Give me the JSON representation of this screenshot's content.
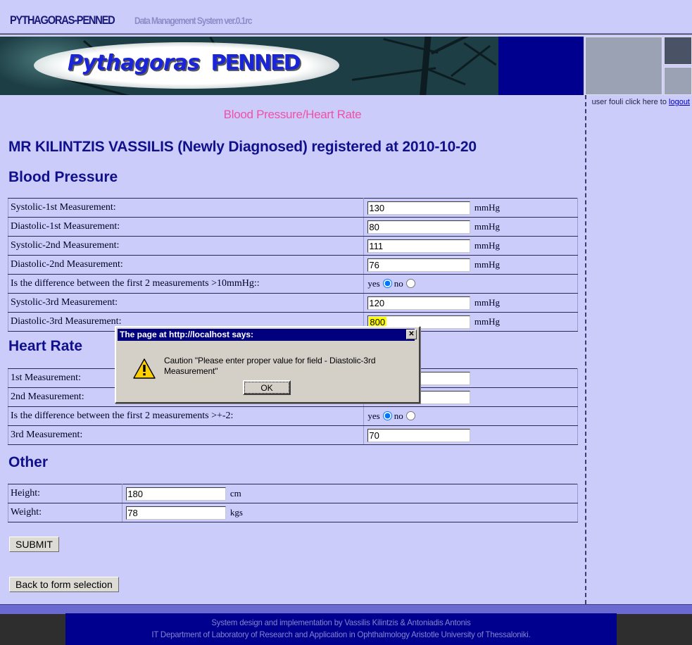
{
  "titlebar": {
    "app_name": "PYTHAGORAS-PENNED",
    "app_subtitle": "Data Management System ver.0.1rc"
  },
  "banner": {
    "logo_first": "Pythagoras",
    "logo_second": "PENNED"
  },
  "session": {
    "prefix": "user fouli click here to",
    "logout_label": "logout"
  },
  "page": {
    "title": "Blood Pressure/Heart Rate",
    "patient_line": "MR KILINTZIS VASSILIS (Newly Diagnosed) registered at 2010-10-20"
  },
  "sections": {
    "blood_pressure": {
      "heading": "Blood Pressure",
      "rows": [
        {
          "label": "Systolic-1st Measurement:",
          "value": "130",
          "unit": "mmHg",
          "type": "text"
        },
        {
          "label": "Diastolic-1st Measurement:",
          "value": "80",
          "unit": "mmHg",
          "type": "text"
        },
        {
          "label": "Systolic-2nd Measurement:",
          "value": "111",
          "unit": "mmHg",
          "type": "text"
        },
        {
          "label": "Diastolic-2nd Measurement:",
          "value": "76",
          "unit": "mmHg",
          "type": "text"
        },
        {
          "label": "Is the difference between the first 2 measurements >10mmHg::",
          "type": "radio",
          "yes_label": "yes",
          "no_label": "no",
          "selected": "yes"
        },
        {
          "label": "Systolic-3rd Measurement:",
          "value": "120",
          "unit": "mmHg",
          "type": "text"
        },
        {
          "label": "Diastolic-3rd Measurement:",
          "value": "800",
          "unit": "mmHg",
          "type": "text",
          "highlighted": true
        }
      ]
    },
    "heart_rate": {
      "heading": "Heart Rate",
      "rows": [
        {
          "label": "1st Measurement:",
          "value": "",
          "unit": "",
          "type": "text"
        },
        {
          "label": "2nd Measurement:",
          "value": "",
          "unit": "",
          "type": "text"
        },
        {
          "label": "Is the difference between the first 2 measurements >+-2:",
          "type": "radio",
          "yes_label": "yes",
          "no_label": "no",
          "selected": "yes"
        },
        {
          "label": "3rd Measurement:",
          "value": "70",
          "unit": "",
          "type": "text"
        }
      ]
    },
    "other": {
      "heading": "Other",
      "rows": [
        {
          "label": "Height:",
          "value": "180",
          "unit": "cm",
          "type": "text"
        },
        {
          "label": "Weight:",
          "value": "78",
          "unit": "kgs",
          "type": "text"
        }
      ]
    }
  },
  "buttons": {
    "submit": "SUBMIT",
    "back": "Back to form selection"
  },
  "dialog": {
    "title": "The page at http://localhost says:",
    "close_label": "✕",
    "message": "Caution \"Please enter proper value for field - Diastolic-3rd Measurement\"",
    "ok_label": "OK",
    "icon": "warning-triangle-icon"
  },
  "footer": {
    "line1": "System design and implementation by Vassilis Kilintzis & Antoniadis Antonis",
    "line2": "IT Department of Laboratory of Research and Application in Ophthalmology Aristotle University of Thessaloniki."
  },
  "colors": {
    "page_bg": "#ccccfa",
    "navy": "#00008f",
    "heading_blue": "#10108c",
    "title_pink": "#f050a8",
    "highlight_yellow": "#ffff00",
    "dialog_face": "#d4d0c8",
    "footer_text": "#8484d0"
  }
}
